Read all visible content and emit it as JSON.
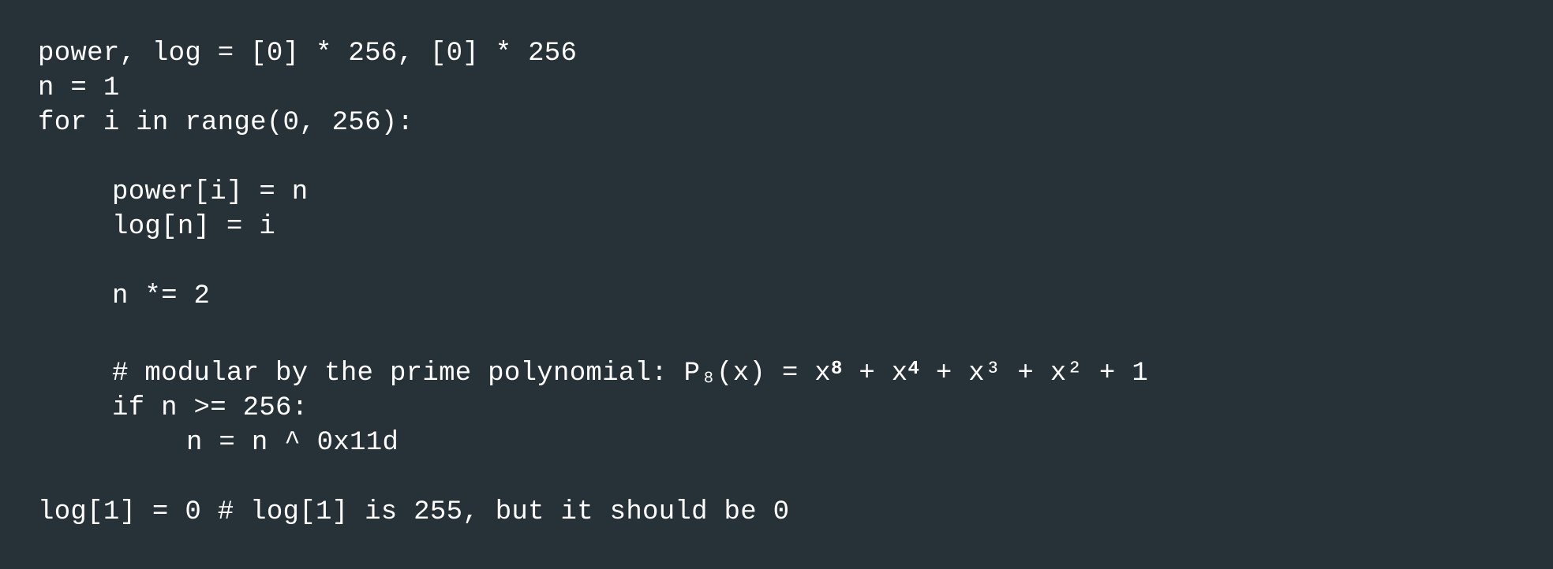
{
  "code": {
    "line1": "power, log = [0] * 256, [0] * 256",
    "line2": "n = 1",
    "line3": "for i in range(0, 256):",
    "line4": "power[i] = n",
    "line5": "log[n] = i",
    "line6": "n *= 2",
    "line7": {
      "prefix": "# modular by the prime polynomial: P₈(x) = x",
      "exp8": "8",
      "mid": " + x",
      "exp4": "4",
      "suffix": " + x³ + x² + 1"
    },
    "line8": "if n >= 256:",
    "line9": "n = n ^ 0x11d",
    "line10": "log[1] = 0 # log[1] is 255, but it should be 0"
  },
  "colors": {
    "background": "#263238",
    "text": "#ffffff"
  }
}
